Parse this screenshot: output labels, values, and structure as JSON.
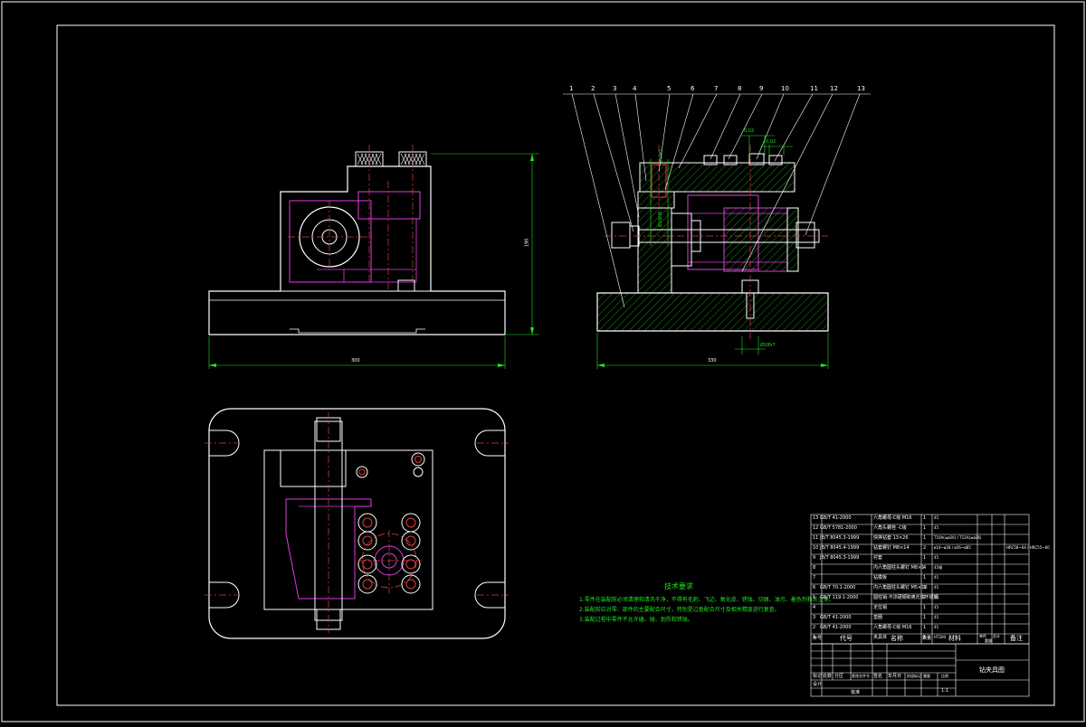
{
  "tech_requirements": {
    "title": "技术要求",
    "lines": [
      "1.零件在装配前必须清理和清洗干净，不得有毛刺、飞边、氧化皮、锈蚀、切屑、油污、着色剂和灰尘等。",
      "2.装配前应对零、部件的主要配合尺寸，特别是过盈配合尺寸及相关精度进行复查。",
      "3.装配过程中零件不允许磕、碰、划伤和锈蚀。"
    ]
  },
  "balloons": [
    "1",
    "2",
    "3",
    "4",
    "5",
    "6",
    "7",
    "8",
    "9",
    "10",
    "11",
    "12",
    "13"
  ],
  "dimensions": {
    "front_width": "300",
    "front_height": "190",
    "side_width": "330",
    "side_top_a": "0.02",
    "side_top_b": "0.02",
    "side_fit": "Ø18h7",
    "side_bore": "Ø16H8",
    "side_left": "Ø10f7"
  },
  "bom": {
    "rows": [
      {
        "no": "13",
        "code": "GB/T 41-2000",
        "name": "六角螺母-C级 M16",
        "qty": "1",
        "mat": "45",
        "note": ""
      },
      {
        "no": "12",
        "code": "GB/T 5781-2000",
        "name": "六角头螺栓 -C级",
        "qty": "1",
        "mat": "45",
        "note": ""
      },
      {
        "no": "11",
        "code": "JB/T 8045.3-1999",
        "name": "快换钻套 13×26",
        "qty": "1",
        "mat": "T10A(≤ø26) / T12A(≥ø26)",
        "note": ""
      },
      {
        "no": "10",
        "code": "JB/T 8045.4-1999",
        "name": "钻套螺钉 M8×14",
        "qty": "2",
        "mat": "ø14~ø28 / ø26~ø85",
        "note": "HRC58~64 / HRC55~60"
      },
      {
        "no": "9",
        "code": "JB/T 8045.3-1999",
        "name": "衬套",
        "qty": "1",
        "mat": "45",
        "note": ""
      },
      {
        "no": "8",
        "code": "",
        "name": "内六角圆柱头螺钉 M8×1",
        "qty": "4",
        "mat": "45钢",
        "note": ""
      },
      {
        "no": "7",
        "code": "",
        "name": "钻模板",
        "qty": "1",
        "mat": "45",
        "note": ""
      },
      {
        "no": "6",
        "code": "GB/T 70.1-2000",
        "name": "内六角圆柱头螺钉 M5×16",
        "qty": "1",
        "mat": "45",
        "note": ""
      },
      {
        "no": "5",
        "code": "GB/T 119.1-2000",
        "name": "圆柱销-不淬硬钢和奥氏体不锈钢",
        "qty": "2",
        "mat": "35",
        "note": ""
      },
      {
        "no": "4",
        "code": "",
        "name": "定位销",
        "qty": "1",
        "mat": "45",
        "note": ""
      },
      {
        "no": "3",
        "code": "GB/T 41-2000",
        "name": "垫圈",
        "qty": "1",
        "mat": "45",
        "note": ""
      },
      {
        "no": "2",
        "code": "GB/T 41-2000",
        "name": "六角螺母-C级 M16",
        "qty": "1",
        "mat": "45",
        "note": ""
      },
      {
        "no": "1",
        "code": "",
        "name": "夹具体",
        "qty": "1",
        "mat": "HT200",
        "note": ""
      }
    ],
    "header": {
      "no": "序号",
      "code": "代号",
      "name": "名称",
      "qty": "数量",
      "mat": "材料",
      "unit": "单件",
      "total": "总计",
      "weight": "重量",
      "note": "备注"
    }
  },
  "title_block": {
    "drawing_name": "钻夹具图",
    "scale": "1:1",
    "row_labels": [
      "标记",
      "处数",
      "分区",
      "更改文件号",
      "签名",
      "年月日"
    ],
    "design": "设计",
    "stage_labels": [
      "阶段标记",
      "重量",
      "比例"
    ],
    "approve": "批准"
  }
}
